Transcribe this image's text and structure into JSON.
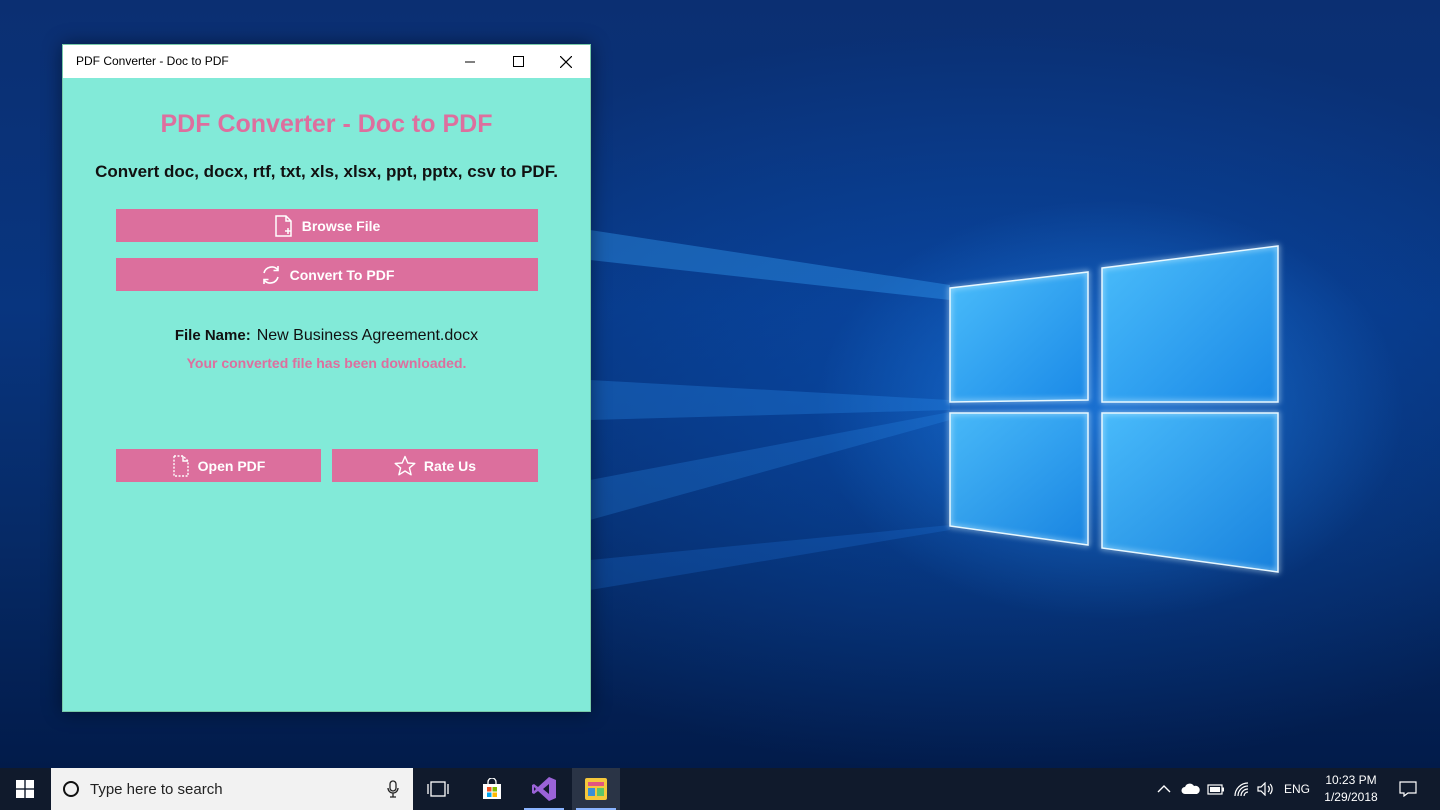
{
  "window": {
    "title": "PDF Converter - Doc to PDF",
    "controls": {
      "minimize": "minimize-icon",
      "maximize": "maximize-icon",
      "close": "close-icon"
    }
  },
  "app": {
    "heading": "PDF Converter - Doc to PDF",
    "subtitle": "Convert doc, docx, rtf, txt, xls, xlsx, ppt, pptx, csv to PDF.",
    "buttons": {
      "browse": {
        "label": "Browse File",
        "icon": "file-add-icon"
      },
      "convert": {
        "label": "Convert To PDF",
        "icon": "refresh-icon"
      },
      "open_pdf": {
        "label": "Open PDF",
        "icon": "document-icon"
      },
      "rate": {
        "label": "Rate Us",
        "icon": "star-icon"
      }
    },
    "file_label": "File Name:",
    "file_name": "New Business Agreement.docx",
    "status": "Your converted file has been downloaded.",
    "colors": {
      "background": "#82ead8",
      "accent": "#dc6f9d",
      "text": "#111111"
    }
  },
  "taskbar": {
    "search_placeholder": "Type here to search",
    "language": "ENG",
    "time": "10:23 PM",
    "date": "1/29/2018",
    "pinned": [
      "task-view-icon",
      "store-icon",
      "visual-studio-icon",
      "pdf-converter-app-icon"
    ],
    "tray": [
      "chevron-up-icon",
      "onedrive-icon",
      "battery-icon",
      "wifi-icon",
      "volume-icon",
      "notification-icon"
    ]
  }
}
